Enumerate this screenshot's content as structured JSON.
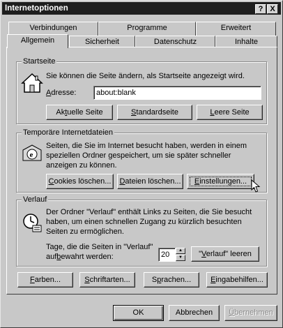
{
  "window": {
    "title": "Internetoptionen",
    "help_glyph": "?",
    "close_glyph": "X"
  },
  "tabs_back": [
    "Verbindungen",
    "Programme",
    "Erweitert"
  ],
  "tabs_front": [
    "Allgemein",
    "Sicherheit",
    "Datenschutz",
    "Inhalte"
  ],
  "active_tab": "Allgemein",
  "startseite": {
    "legend": "Startseite",
    "description": "Sie können die Seite ändern, als Startseite angezeigt wird.",
    "address_label": "Adresse:",
    "address_value": "about:blank",
    "buttons": [
      "Aktuelle Seite",
      "Standardseite",
      "Leere Seite"
    ]
  },
  "temp_files": {
    "legend": "Temporäre Internetdateien",
    "description_lines": [
      "Seiten, die Sie im Internet besucht haben, werden in einem",
      "speziellen Ordner gespeichert, um sie später schneller",
      "anzeigen zu können."
    ],
    "buttons": [
      "Cookies löschen...",
      "Dateien löschen...",
      "Einstellungen..."
    ]
  },
  "history": {
    "legend": "Verlauf",
    "description_lines": [
      "Der Ordner \"Verlauf\" enthält Links zu Seiten, die Sie besucht",
      "haben, um einen schnellen Zugang zu kürzlich besuchten",
      "Seiten zu ermöglichen."
    ],
    "days_label_lines": [
      "Tage, die die Seiten in \"Verlauf\"",
      "aufbewahrt werden:"
    ],
    "days_value": "20",
    "clear_button": "\"Verlauf\" leeren"
  },
  "bottom_buttons": [
    "Farben...",
    "Schriftarten...",
    "Sprachen...",
    "Eingabehilfen..."
  ],
  "dialog_buttons": {
    "ok": "OK",
    "cancel": "Abbrechen",
    "apply": "Übernehmen"
  },
  "icons": {
    "startseite": "house-icon",
    "temp_files": "ie-cache-icon",
    "history": "history-clock-icon",
    "cursor": "mouse-pointer-icon"
  }
}
